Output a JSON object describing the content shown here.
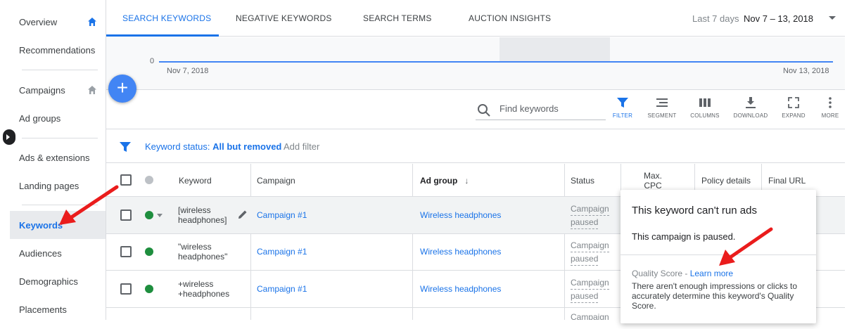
{
  "sidebar": {
    "items": [
      {
        "label": "Overview"
      },
      {
        "label": "Recommendations"
      },
      {
        "label": "Campaigns"
      },
      {
        "label": "Ad groups"
      },
      {
        "label": "Ads & extensions"
      },
      {
        "label": "Landing pages"
      },
      {
        "label": "Keywords"
      },
      {
        "label": "Audiences"
      },
      {
        "label": "Demographics"
      },
      {
        "label": "Placements"
      }
    ],
    "active": "Keywords"
  },
  "tabs": [
    {
      "label": "SEARCH KEYWORDS"
    },
    {
      "label": "NEGATIVE KEYWORDS"
    },
    {
      "label": "SEARCH TERMS"
    },
    {
      "label": "AUCTION INSIGHTS"
    }
  ],
  "date": {
    "label": "Last 7 days",
    "range": "Nov 7 – 13, 2018"
  },
  "chart": {
    "y_zero": "0",
    "x_start": "Nov 7, 2018",
    "x_end": "Nov 13, 2018"
  },
  "fab": {
    "label": "+"
  },
  "toolbar": {
    "search_placeholder": "Find keywords",
    "tools": [
      {
        "label": "FILTER"
      },
      {
        "label": "SEGMENT"
      },
      {
        "label": "COLUMNS"
      },
      {
        "label": "DOWNLOAD"
      },
      {
        "label": "EXPAND"
      },
      {
        "label": "MORE"
      }
    ]
  },
  "filter": {
    "prefix": "Keyword status:",
    "value": "All but removed",
    "add": "Add filter"
  },
  "table": {
    "headers": {
      "keyword": "Keyword",
      "campaign": "Campaign",
      "ad_group": "Ad group",
      "ad_group_sort": "↓",
      "status": "Status",
      "max_cpc_1": "Max.",
      "max_cpc_2": "CPC",
      "policy": "Policy details",
      "final_url": "Final URL"
    },
    "rows": [
      {
        "kw1": "[wireless",
        "kw2": "headphones]",
        "campaign": "Campaign #1",
        "ad_group": "Wireless headphones",
        "status1": "Campaign",
        "status2": "paused"
      },
      {
        "kw1": "\"wireless",
        "kw2": "headphones\"",
        "campaign": "Campaign #1",
        "ad_group": "Wireless headphones",
        "status1": "Campaign",
        "status2": "paused"
      },
      {
        "kw1": "+wireless",
        "kw2": "+headphones",
        "campaign": "Campaign #1",
        "ad_group": "Wireless headphones",
        "status1": "Campaign",
        "status2": "paused"
      }
    ],
    "partial_status": "Campaign"
  },
  "popup": {
    "title": "This keyword can't run ads",
    "body": "This campaign is paused.",
    "qs_label": "Quality Score - ",
    "qs_link": "Learn more",
    "qs_desc": "There aren't enough impressions or clicks to accurately determine this keyword's Quality Score."
  },
  "colors": {
    "accent": "#1a73e8",
    "fab": "#4285f4",
    "green": "#1e8e3e",
    "arrow": "#ea1c1c"
  }
}
